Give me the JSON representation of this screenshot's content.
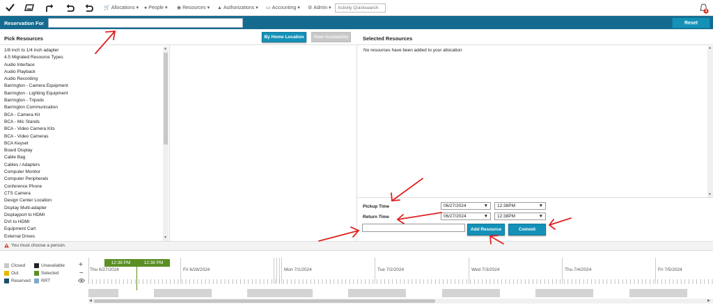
{
  "toolbar": {
    "icons": [
      "check-icon",
      "clear-icon",
      "export-icon",
      "undo-icon",
      "redo-icon"
    ],
    "menus": [
      {
        "label": "Allocations",
        "icon": "cart-icon"
      },
      {
        "label": "People",
        "icon": "people-icon"
      },
      {
        "label": "Resources",
        "icon": "camera-icon"
      },
      {
        "label": "Authorizations",
        "icon": "thumb-icon"
      },
      {
        "label": "Accounting",
        "icon": "card-icon"
      },
      {
        "label": "Admin",
        "icon": "gear-icon"
      }
    ],
    "search_placeholder": "Activity Quicksearch",
    "notification_count": "1"
  },
  "reservation": {
    "label": "Reservation For",
    "value": "",
    "reset_label": "Reset"
  },
  "pick": {
    "title": "Pick Resources",
    "home_location_label": "By Home Location",
    "view_availability_label": "View Availability",
    "items": [
      "1/8 inch to 1/4 inch adapter",
      "4.5 Migrated Resource Types",
      "Audio Interface",
      "Audio Playback",
      "Audio Recording",
      "Barrington - Camera Equipment",
      "Barrington - Lighting Equipment",
      "Barrington - Tripods",
      "Barrington Communication",
      "BCA - Camera Kit",
      "BCA - Mic Stands",
      "BCA - Video Camera Kits",
      "BCA - Video Cameras",
      "BCA Keyset",
      "Board Display",
      "Cable Bag",
      "Cables / Adapters",
      "Computer Monitor",
      "Computer Peripherals",
      "Conference Phone",
      "CTS Camera",
      "Design Center Location",
      "Display Multi-adapter",
      "Displayport to HDMI",
      "DVI to HDMI",
      "Equipment Cart",
      "External Drives"
    ]
  },
  "selected": {
    "title": "Selected Resources",
    "empty_message": "No resources have been added to your allocation",
    "pickup_label": "Pickup Time",
    "pickup_date": "06/27/2024",
    "pickup_time": "12:38PM",
    "return_label": "Return Time",
    "return_date": "06/27/2024",
    "return_time": "12:38PM",
    "add_resource_label": "Add Resource",
    "commit_label": "Commit"
  },
  "warning": "You must choose a person.",
  "legend": [
    {
      "label": "Closed",
      "color": "#c8c8c8"
    },
    {
      "label": "Unavailable",
      "color": "#222222"
    },
    {
      "label": "Out",
      "color": "#e6b800"
    },
    {
      "label": "Selected",
      "color": "#5a8f23"
    },
    {
      "label": "Reserved",
      "color": "#1b4f6b"
    },
    {
      "label": "RRT",
      "color": "#7fa8c9"
    }
  ],
  "timeline": {
    "now_labels": [
      "12:38 PM",
      "12:38 PM"
    ],
    "days": [
      "Thu 6/27/2024",
      "Fri 6/28/2024",
      "Mon 7/1/2024",
      "Tue 7/2/2024",
      "Wed 7/3/2024",
      "Thu 7/4/2024",
      "Fri 7/5/2024"
    ]
  }
}
